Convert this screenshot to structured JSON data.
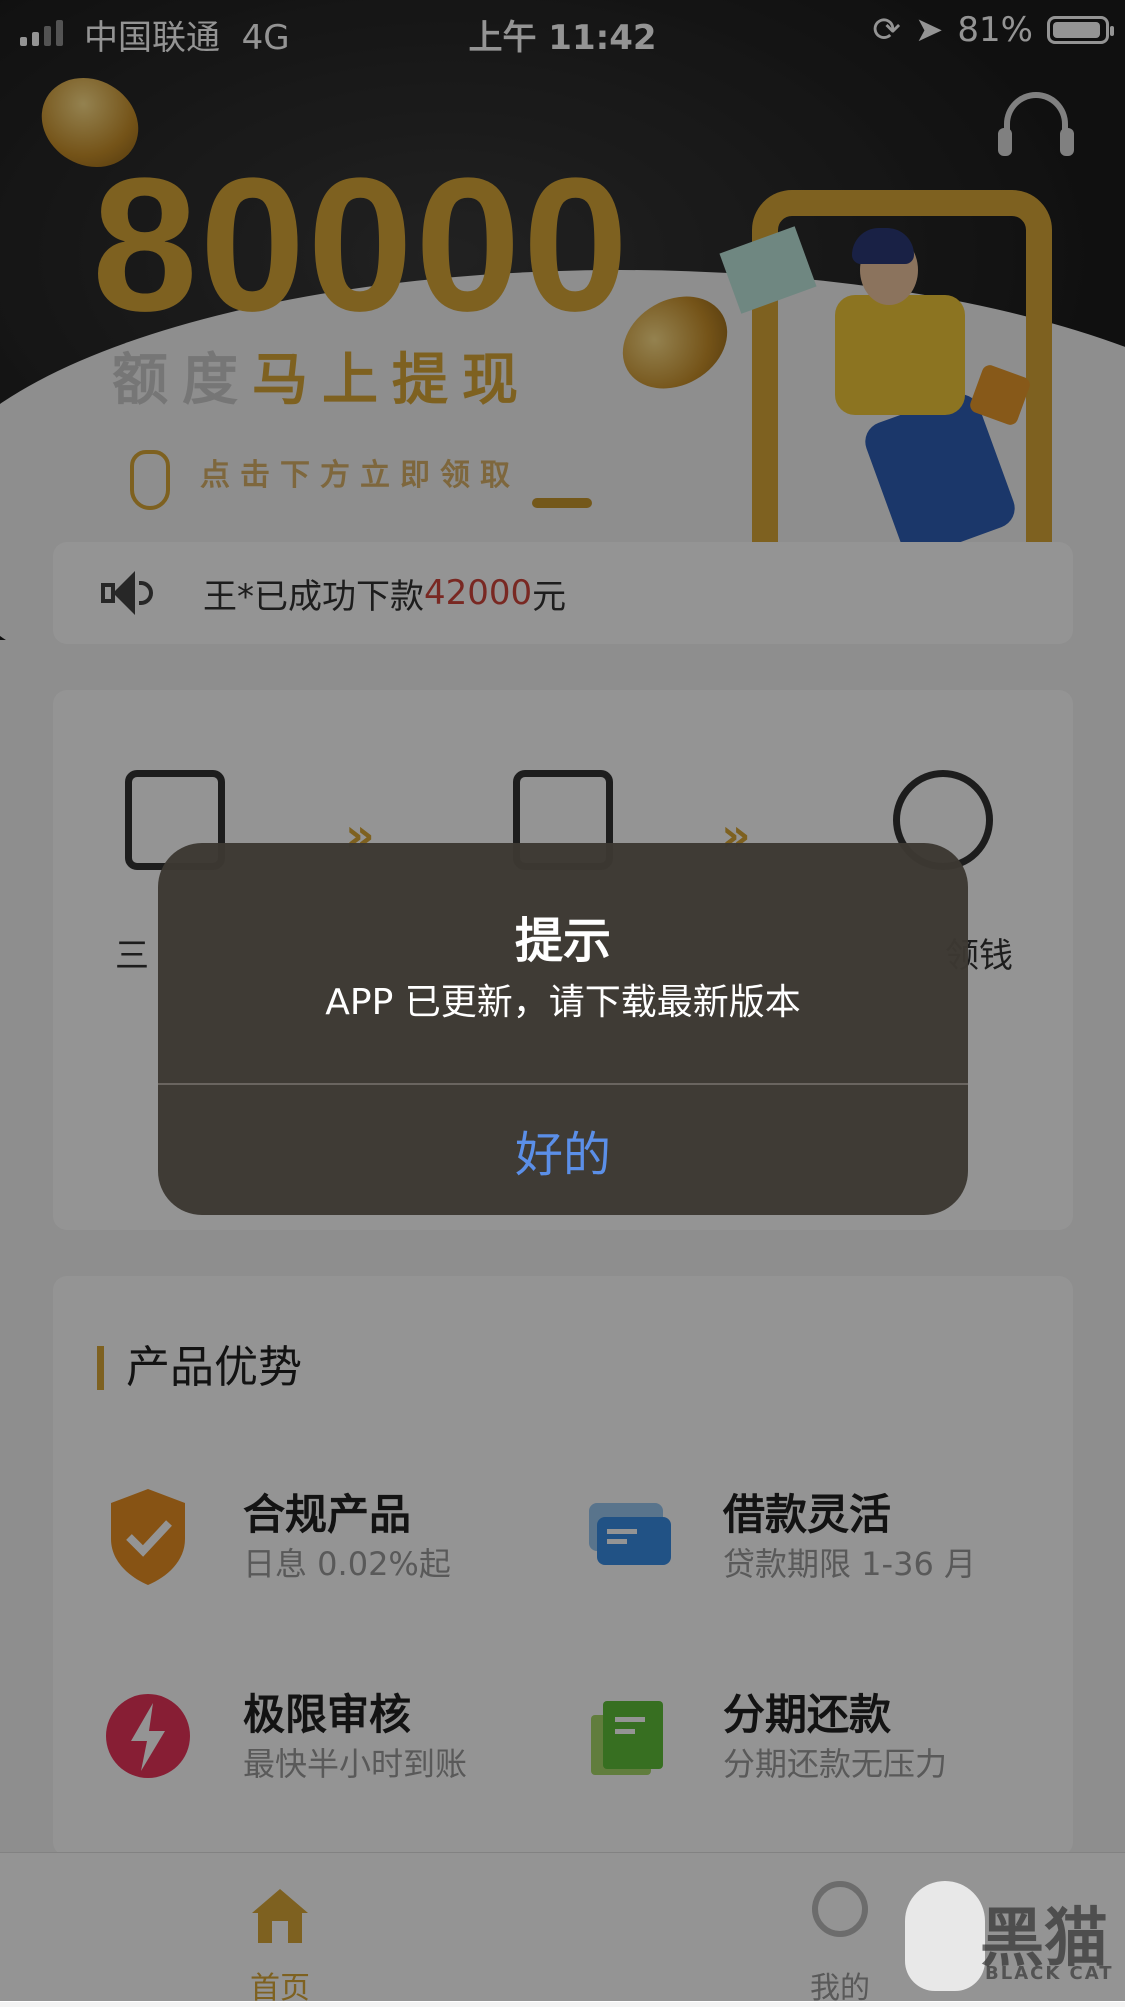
{
  "status_bar": {
    "carrier": "中国联通",
    "network": "4G",
    "time": "上午 11:42",
    "battery": "81%",
    "battery_level": 0.81
  },
  "hero": {
    "amount": "80000",
    "subtitle_plain": "额度",
    "subtitle_gold": "马上提现",
    "tap_hint": "点击下方立即领取"
  },
  "notice": {
    "prefix": "王*已成功下款",
    "amount": "42000",
    "suffix": "元"
  },
  "steps": {
    "left_partial": "三",
    "right_partial": "领钱"
  },
  "advantages": {
    "title": "产品优势",
    "items": [
      {
        "name": "合规产品",
        "desc": "日息 0.02%起"
      },
      {
        "name": "借款灵活",
        "desc": "贷款期限 1-36 月"
      },
      {
        "name": "极限审核",
        "desc": "最快半小时到账"
      },
      {
        "name": "分期还款",
        "desc": "分期还款无压力"
      }
    ]
  },
  "tabbar": {
    "home": "首页",
    "me": "我的"
  },
  "dialog": {
    "title": "提示",
    "message": "APP 已更新，请下载最新版本",
    "ok": "好的"
  },
  "watermark": {
    "text": "黑猫",
    "sub": "BLACK CAT"
  },
  "colors": {
    "accent_gold": "#d9a838",
    "amount_red": "#d0453b",
    "dialog_button": "#5b8fe8"
  }
}
